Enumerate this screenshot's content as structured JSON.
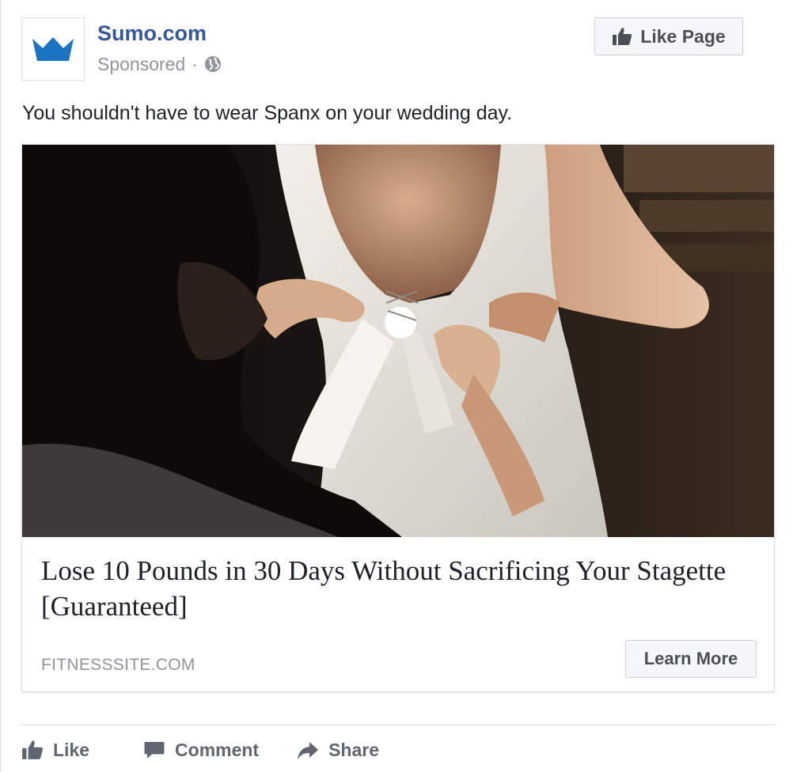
{
  "post": {
    "page_name": "Sumo.com",
    "sponsored_label": "Sponsored",
    "separator": "·",
    "like_page_label": "Like Page",
    "caption": "You shouldn't have to wear Spanx on your wedding day."
  },
  "link_card": {
    "headline": "Lose 10 Pounds in 30 Days Without Sacrificing Your Stagette [Guaranteed]",
    "domain": "FITNESSSITE.COM",
    "cta_label": "Learn More"
  },
  "actions": {
    "like_label": "Like",
    "comment_label": "Comment",
    "share_label": "Share"
  },
  "icons": {
    "avatar": "crown-icon",
    "audience": "globe-icon",
    "like_page": "thumbs-up-icon",
    "like": "thumbs-up-icon",
    "comment": "comment-bubble-icon",
    "share": "share-arrow-icon"
  },
  "colors": {
    "brand_link": "#365899",
    "crown": "#1a74c2",
    "muted_text": "#90949c",
    "button_text": "#4b4f56",
    "action_text": "#606770"
  }
}
